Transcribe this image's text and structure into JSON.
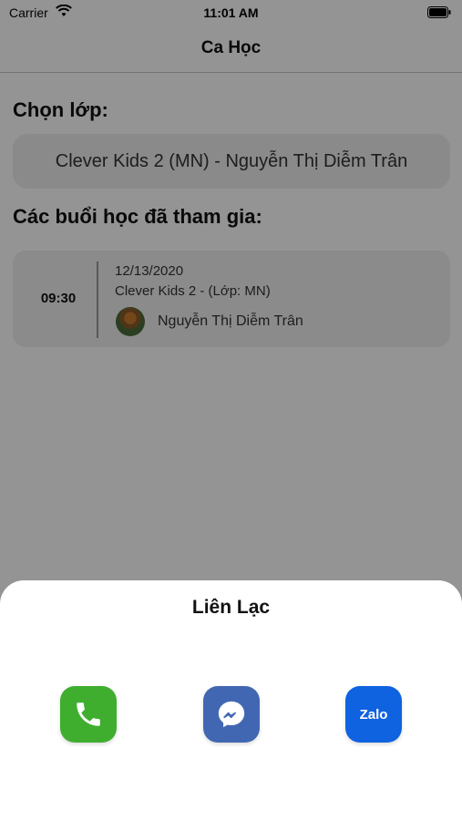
{
  "status_bar": {
    "carrier": "Carrier",
    "time": "11:01 AM"
  },
  "nav": {
    "title": "Ca Học"
  },
  "class_section": {
    "label": "Chọn lớp:",
    "selected_class": "Clever Kids 2 (MN) - Nguyễn Thị Diễm Trân"
  },
  "sessions_section": {
    "label": "Các buổi học đã tham gia:",
    "items": [
      {
        "time": "09:30",
        "date": "12/13/2020",
        "class": "Clever Kids 2 - (Lớp: MN)",
        "teacher": "Nguyễn Thị Diễm Trân"
      }
    ]
  },
  "contact_sheet": {
    "title": "Liên Lạc",
    "buttons": [
      {
        "icon": "phone-icon",
        "color": "#3fae2f"
      },
      {
        "icon": "messenger-icon",
        "color": "#4267b2"
      },
      {
        "icon": "zalo-icon",
        "label": "Zalo",
        "color": "#0f62e0"
      }
    ]
  }
}
